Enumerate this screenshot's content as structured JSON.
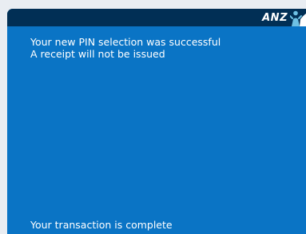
{
  "header": {
    "brand": "ANZ",
    "logo_icon": "anz-person-logo-icon",
    "bar_color": "#012f55"
  },
  "screen": {
    "background_color": "#0a74c5",
    "messages": [
      "Your new PIN selection was successful",
      "A receipt will not be issued"
    ],
    "footer": "Your transaction is complete"
  }
}
